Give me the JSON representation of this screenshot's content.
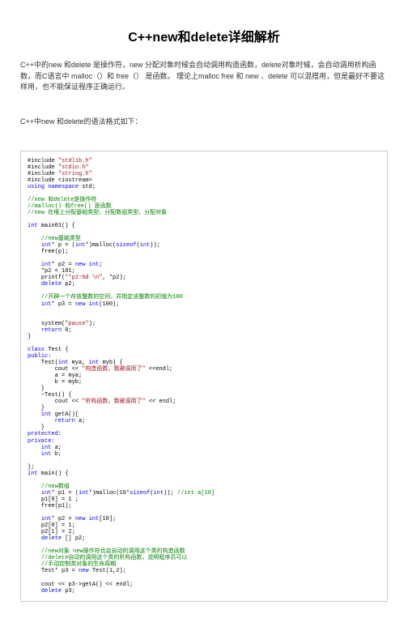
{
  "title": "C++new和delete详细解析",
  "intro": "C++中的new 和delete 是操作符，new 分配对象时候会自动调用构造函数，delete对象时候，会自动调用析构函数，而C语言中 malloc（）和 free（） 是函数。 理论上malloc free 和 new 、delete 可以混搭用，但是最好不要这样用，也不能保证程序正确运行。",
  "subheading": "C++中new 和delete的语法格式如下：",
  "code": {
    "l1": "#include ",
    "l1s": "\"stdlib.h\"",
    "l2": "#include ",
    "l2s": "\"stdio.h\"",
    "l3": "#include ",
    "l3s": "\"string.h\"",
    "l4": "#include <iostream>",
    "l5a": "using",
    "l5b": " namespace",
    "l5c": " std;",
    "c1": "//new 和delete是操作符",
    "c2": "//malloc() 和free() 是函数",
    "c3": "//new 在堆上分配基础类型、分配数组类型、分配对象",
    "l6a": "int",
    "l6b": " main01() {",
    "c4": "//new基础类型",
    "l7a": "int",
    "l7b": "* p = (",
    "l7c": "int",
    "l7d": "*)malloc(",
    "l7e": "sizeof",
    "l7f": "(",
    "l7g": "int",
    "l7h": "));",
    "l8": "free(p);",
    "l9a": "int",
    "l9b": "* p2 = ",
    "l9c": "new",
    "l9d": " int",
    "l9e": ";",
    "l10": "*p2 = 101;",
    "l11a": "printf(",
    "l11b": "\"*p2:%d \\n\"",
    "l11c": ", *p2);",
    "l12a": "delete",
    "l12b": " p2;",
    "c5": "//开辟一个存放整数的空间，并指定该整数的初值为100",
    "l13a": "int",
    "l13b": "* p3 = ",
    "l13c": "new",
    "l13d": " int",
    "l13e": "(100);",
    "l14a": "system(",
    "l14b": "\"pause\"",
    "l14c": ");",
    "l15a": "return",
    "l15b": " 0;",
    "l16": "}",
    "l17a": "class",
    "l17b": " Test {",
    "l18": "public:",
    "l19a": "    Test(",
    "l19b": "int",
    "l19c": " mya, ",
    "l19d": "int",
    "l19e": " myb) {",
    "l20a": "        cout << ",
    "l20b": "\"构造函数，我被调用了\"",
    "l20c": " <<endl;",
    "l21": "        a = mya;",
    "l22": "        b = myb;",
    "l23": "    }",
    "l24": "    ~Test() {",
    "l25a": "        cout << ",
    "l25b": "\"析构函数，我被调用了\"",
    "l25c": " << endl;",
    "l26": "    }",
    "l27a": "    int",
    "l27b": " getA(){",
    "l28a": "        return",
    "l28b": " a;",
    "l29": "    }",
    "l30": "protected:",
    "l31": "private:",
    "l32a": "    int",
    "l32b": " a;",
    "l33a": "    int",
    "l33b": " b;",
    "l34": "};",
    "l35a": "int",
    "l35b": " main() {",
    "c6": "//new数组",
    "l36a": "int",
    "l36b": "* p1 = (",
    "l36c": "int",
    "l36d": "*)malloc(10*",
    "l36e": "sizeof",
    "l36f": "(",
    "l36g": "int",
    "l36h": ")); ",
    "l36i": "//int a[10]",
    "l37": "p1[0] = 1 ;",
    "l38": "free(p1);",
    "l39a": "int",
    "l39b": "* p2 = ",
    "l39c": "new",
    "l39d": " int",
    "l39e": "[10];",
    "l40": "p2[0] = 1;",
    "l41": "p2[1] = 2;",
    "l42a": "delete",
    "l42b": " [] p2;",
    "c7": "//new对象 new操作符也会自动的调用这个类的构造函数",
    "c8": "//delete自动的调用这个类的析构函数，说明程序员可以",
    "c9": "//手动控制类对象的生命周期",
    "l43a": "Test* p3 = ",
    "l43b": "new",
    "l43c": " Test(1,2);",
    "l44": "cout << p3->getA() << endl;",
    "l45a": "delete",
    "l45b": " p3;"
  }
}
